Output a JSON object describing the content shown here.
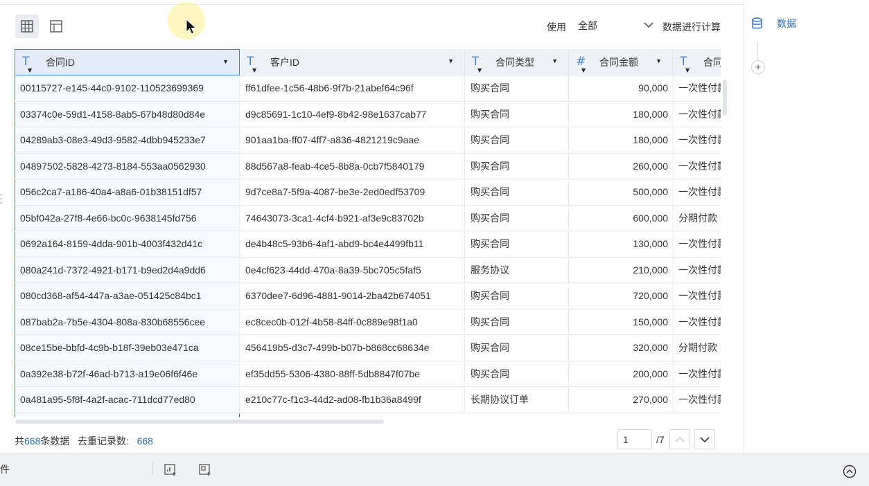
{
  "toolbar": {
    "use_label": "使用",
    "scope_value": "全部",
    "calc_label": "数据进行计算"
  },
  "right_panel": {
    "data_tab_label": "数据",
    "add_label": "+"
  },
  "table": {
    "columns": [
      {
        "type_icon": "T",
        "name": "合同ID"
      },
      {
        "type_icon": "T",
        "name": "客户ID"
      },
      {
        "type_icon": "T",
        "name": "合同类型"
      },
      {
        "type_icon": "#",
        "name": "合同金额"
      },
      {
        "type_icon": "T",
        "name": "合同"
      }
    ],
    "rows": [
      [
        "00115727-e145-44c0-9102-110523699369",
        "ff61dfee-1c56-48b6-9f7b-21abef64c96f",
        "购买合同",
        "90,000",
        "一次性付款"
      ],
      [
        "03374c0e-59d1-4158-8ab5-67b48d80d84e",
        "d9c85691-1c10-4ef9-8b42-98e1637cab77",
        "购买合同",
        "180,000",
        "一次性付款"
      ],
      [
        "04289ab3-08e3-49d3-9582-4dbb945233e7",
        "901aa1ba-ff07-4ff7-a836-4821219c9aae",
        "购买合同",
        "180,000",
        "一次性付款"
      ],
      [
        "04897502-5828-4273-8184-553aa0562930",
        "88d567a8-feab-4ce5-8b8a-0cb7f5840179",
        "购买合同",
        "260,000",
        "一次性付款"
      ],
      [
        "056c2ca7-a186-40a4-a8a6-01b38151df57",
        "9d7ce8a7-5f9a-4087-be3e-2ed0edf53709",
        "购买合同",
        "500,000",
        "一次性付款"
      ],
      [
        "05bf042a-27f8-4e66-bc0c-9638145fd756",
        "74643073-3ca1-4cf4-b921-af3e9c83702b",
        "购买合同",
        "600,000",
        "分期付款"
      ],
      [
        "0692a164-8159-4dda-901b-4003f432d41c",
        "de4b48c5-93b6-4af1-abd9-bc4e4499fb11",
        "购买合同",
        "130,000",
        "一次性付款"
      ],
      [
        "080a241d-7372-4921-b171-b9ed2d4a9dd6",
        "0e4cf623-44dd-470a-8a39-5bc705c5faf5",
        "服务协议",
        "210,000",
        "一次性付款"
      ],
      [
        "080cd368-af54-447a-a3ae-051425c84bc1",
        "6370dee7-6d96-4881-9014-2ba42b674051",
        "购买合同",
        "720,000",
        "一次性付款"
      ],
      [
        "087bab2a-7b5e-4304-808a-830b68556cee",
        "ec8cec0b-012f-4b58-84ff-0c889e98f1a0",
        "购买合同",
        "150,000",
        "一次性付款"
      ],
      [
        "08ce15be-bbfd-4c9b-b18f-39eb03e471ca",
        "456419b5-d3c7-499b-b07b-b868cc68634e",
        "购买合同",
        "320,000",
        "分期付款"
      ],
      [
        "0a392e38-b72f-46ad-b713-a19e06f6f46e",
        "ef35dd55-5306-4380-88ff-5db8847f07be",
        "购买合同",
        "200,000",
        "一次性付款"
      ],
      [
        "0a481a95-5f8f-4a2f-acac-711dcd77ed80",
        "e210c77c-f1c3-44d2-ad08-fb1b36a8499f",
        "长期协议订单",
        "270,000",
        "一次性付款"
      ]
    ]
  },
  "footer": {
    "total_prefix": "共",
    "total_count": "668",
    "total_suffix": "条数据",
    "dedup_label": "去重记录数:",
    "dedup_count": "668",
    "page_input_value": "1",
    "page_total": "/7"
  },
  "bottom_bar": {
    "label": "组件"
  },
  "colors": {
    "accent": "#2f6db5",
    "type_icon": "#4b84cf",
    "selected_border": "#4a7fc8",
    "header_bg": "#eef1f6"
  }
}
